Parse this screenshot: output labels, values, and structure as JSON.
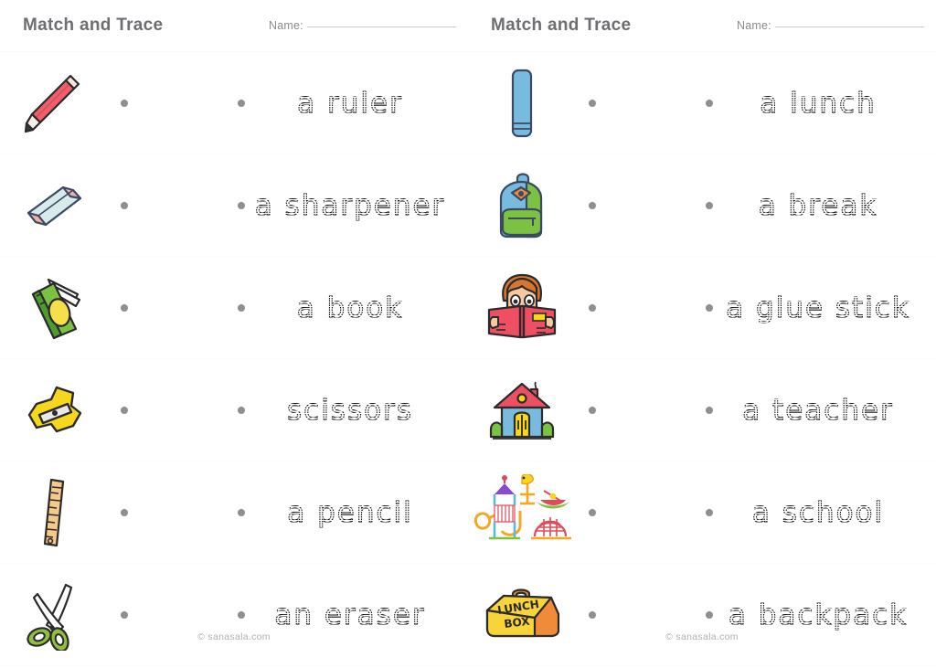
{
  "page": {
    "footer_text": "© sanasala.com",
    "background": "#ffffff",
    "dot_color": "#8e8e93",
    "title_color": "#6e6e72"
  },
  "panels": [
    {
      "id": "left-panel",
      "title": "Match and Trace",
      "name_label": "Name:",
      "footer": "© sanasala.com",
      "rows": [
        {
          "picture": "pencil-red-icon",
          "word": "a ruler"
        },
        {
          "picture": "eraser-icon",
          "word": "a sharpener"
        },
        {
          "picture": "book-green-icon",
          "word": "a book"
        },
        {
          "picture": "sharpener-yellow-icon",
          "word": "scissors"
        },
        {
          "picture": "ruler-wooden-icon",
          "word": "a pencil"
        },
        {
          "picture": "scissors-green-icon",
          "word": "an eraser"
        }
      ]
    },
    {
      "id": "right-panel",
      "title": "Match and Trace",
      "name_label": "Name:",
      "footer": "© sanasala.com",
      "rows": [
        {
          "picture": "glue-stick-icon",
          "word": "a lunch"
        },
        {
          "picture": "backpack-icon",
          "word": "a break"
        },
        {
          "picture": "reading-boy-icon",
          "word": "a glue stick"
        },
        {
          "picture": "school-house-icon",
          "word": "a teacher"
        },
        {
          "picture": "playground-icon",
          "word": "a school"
        },
        {
          "picture": "lunch-box-icon",
          "word": "a backpack"
        }
      ]
    }
  ],
  "icon_colors": {
    "pencil_body": "#ef5f6b",
    "pencil_tip": "#3a3a3a",
    "eraser_pink": "#f3b0a6",
    "eraser_blue": "#d9eaea",
    "book_green": "#7cc242",
    "book_dark_green": "#4d9c2f",
    "book_oval": "#f5e04a",
    "sharpener_yellow": "#f5d71e",
    "ruler_tan": "#f5c98a",
    "scissors_green": "#8fbf3f",
    "glue_blue": "#6fb5dd",
    "backpack_blue": "#6fb5dd",
    "backpack_green": "#7cc242",
    "hair_orange": "#d8762f",
    "skin": "#f6c9a0",
    "book_pink": "#ef4f63",
    "roof_pink": "#ef4f63",
    "house_blue": "#6fb5dd",
    "door_yellow": "#f5d71e",
    "bush_green": "#7cc242",
    "lunch_yellow": "#f8d33a",
    "lunch_orange": "#ef8b2c",
    "playground_orange": "#f5a623",
    "outline": "#2b2b2b"
  },
  "lunch_box_text": {
    "line1": "LUNCH",
    "line2": "BOX"
  }
}
